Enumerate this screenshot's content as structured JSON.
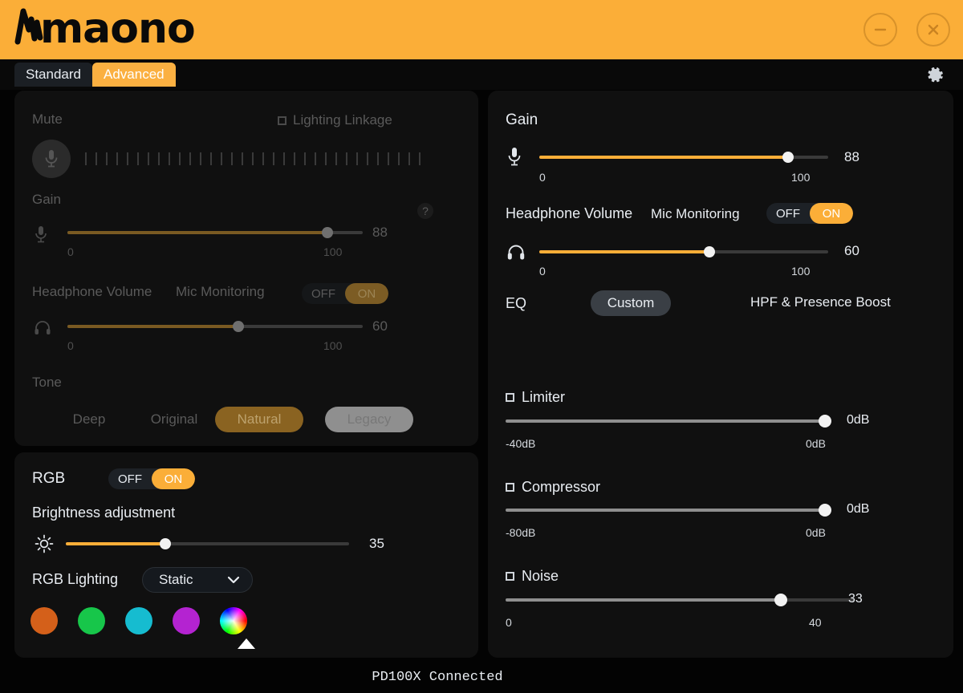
{
  "app": {
    "brand": "maono",
    "window_controls": {
      "minimize": "minimize-button",
      "close": "close-button"
    }
  },
  "tabs": [
    {
      "label": "Standard",
      "active": false
    },
    {
      "label": "Advanced",
      "active": true
    }
  ],
  "settings_icon": "gear-icon",
  "standard_panel": {
    "mute_label": "Mute",
    "lighting_linkage_label": "Lighting Linkage",
    "lighting_linkage_checked": false,
    "help_label": "?",
    "gain": {
      "label": "Gain",
      "value": "88",
      "min": "0",
      "max": "100",
      "percent": 88
    },
    "headphone": {
      "label": "Headphone Volume",
      "mic_monitoring_label": "Mic Monitoring",
      "toggle_off": "OFF",
      "toggle_on": "ON",
      "toggle_state": "ON",
      "value": "60",
      "min": "0",
      "max": "100",
      "percent": 58
    },
    "tone": {
      "label": "Tone",
      "options": [
        "Deep",
        "Original",
        "Natural",
        "Legacy"
      ],
      "selected": "Natural",
      "highlighted": "Legacy"
    }
  },
  "rgb_panel": {
    "label": "RGB",
    "toggle_off": "OFF",
    "toggle_on": "ON",
    "toggle_state": "ON",
    "brightness_label": "Brightness adjustment",
    "brightness_value": "35",
    "brightness_percent": 35,
    "lighting_label": "RGB Lighting",
    "lighting_mode": "Static",
    "swatches": [
      "#D4601A",
      "#17C64A",
      "#16BCD0",
      "#B423D1"
    ],
    "wheel_selected": true
  },
  "advanced_panel": {
    "gain": {
      "label": "Gain",
      "value": "88",
      "min": "0",
      "max": "100",
      "percent": 86
    },
    "headphone": {
      "label": "Headphone Volume",
      "mic_monitoring_label": "Mic Monitoring",
      "toggle_off": "OFF",
      "toggle_on": "ON",
      "toggle_state": "ON",
      "value": "60",
      "min": "0",
      "max": "100",
      "percent": 59
    },
    "eq": {
      "label": "EQ",
      "custom_label": "Custom",
      "preset_name": "HPF & Presence Boost",
      "curves": [
        "flat-curve",
        "highpass-curve",
        "presence-bump-curve",
        "hpf-presence-boost-curve"
      ],
      "selected_index": 3
    },
    "limiter": {
      "label": "Limiter",
      "checked": false,
      "value": "0dB",
      "min": "-40dB",
      "max": "0dB",
      "percent": 100
    },
    "compressor": {
      "label": "Compressor",
      "checked": false,
      "value": "0dB",
      "min": "-80dB",
      "max": "0dB",
      "percent": 100
    },
    "noise": {
      "label": "Noise",
      "checked": false,
      "value": "33",
      "min": "0",
      "max": "40",
      "percent": 79
    }
  },
  "status_bar": {
    "text": "PD100X  Connected"
  },
  "colors": {
    "accent": "#FBAE38",
    "titlebar": "#FBAE38",
    "panel_bg": "#101010",
    "app_bg": "#030303"
  }
}
